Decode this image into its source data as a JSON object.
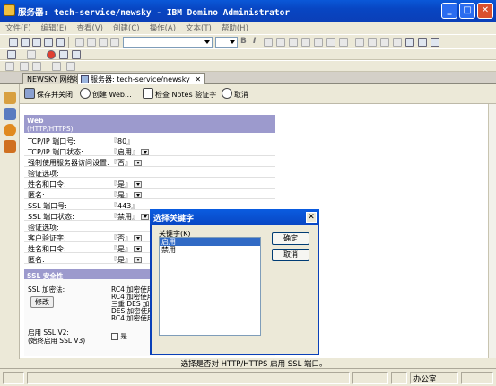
{
  "window": {
    "title": "服务器: tech-service/newsky - IBM Domino Administrator",
    "minimize": "_",
    "maximize": "□",
    "close": "✕"
  },
  "menu": [
    "文件(F)",
    "编辑(E)",
    "查看(V)",
    "创建(C)",
    "操作(A)",
    "文本(T)",
    "帮助(H)"
  ],
  "tabs": [
    {
      "label": "NEWSKY 网络域"
    },
    {
      "label": "服务器: tech-service/newsky",
      "close": "✕"
    }
  ],
  "actions": {
    "save_close": "保存并关闭",
    "create_web": "创建 Web...",
    "check_notes_cert": "检查 Notes 验证字",
    "cancel": "取消"
  },
  "form": {
    "web_section_title": "Web",
    "web_section_subtitle": "(HTTP/HTTPS)",
    "rows": [
      {
        "label": "TCP/IP 端口号:",
        "value": "80"
      },
      {
        "label": "TCP/IP 端口状态:",
        "value": "启用"
      },
      {
        "label": "强制使用服务器访问设置:",
        "value": "否"
      },
      {
        "label": "验证选项:",
        "value": ""
      },
      {
        "label": "姓名和口令:",
        "value": "是"
      },
      {
        "label": "匿名:",
        "value": "是"
      },
      {
        "label": "SSL 端口号:",
        "value": "443"
      },
      {
        "label": "SSL 端口状态:",
        "value": "禁用"
      },
      {
        "label": "验证选项:",
        "value": ""
      },
      {
        "label": "客户验证字:",
        "value": "否"
      },
      {
        "label": "姓名和口令:",
        "value": "是"
      },
      {
        "label": "匿名:",
        "value": "是"
      }
    ],
    "ssl_section_title": "SSL 安全性",
    "ssl_cipher_label": "SSL 加密法:",
    "ssl_ciphers": [
      "RC4 加密使用",
      "RC4 加密使用",
      "三重 DES 加",
      "DES 加密使用",
      "RC4 加密使用"
    ],
    "modify_button": "修改",
    "ssl_v2_label": "启用 SSL V2:",
    "ssl_v2_sub": "(始终启用 SSL V3)",
    "ssl_v2_value": "是"
  },
  "hint": "选择是否对 HTTP/HTTPS 启用 SSL 端口。",
  "status": {
    "location": "办公室"
  },
  "dialog": {
    "title": "选择关键字",
    "label": "关键字(K)",
    "options": [
      "启用",
      "禁用"
    ],
    "selected_index": 0,
    "ok": "确定",
    "cancel": "取消",
    "close": "✕"
  }
}
